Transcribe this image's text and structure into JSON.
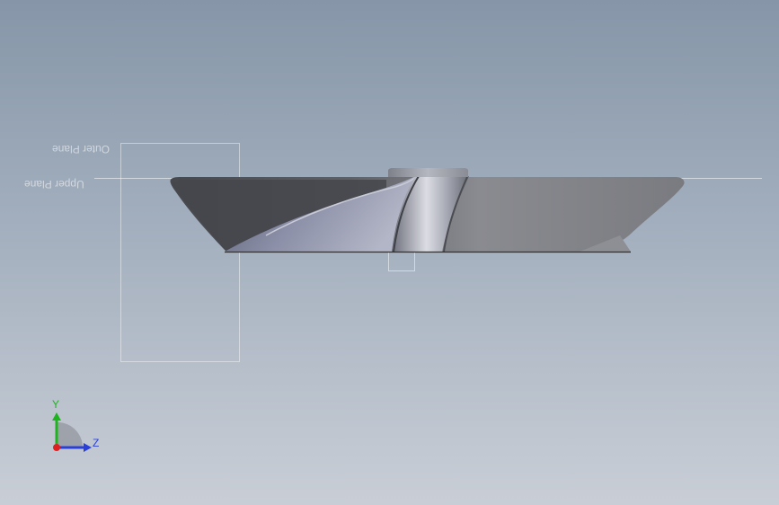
{
  "viewport": {
    "background_top": "#8696a8",
    "background_bottom": "#c9ced6"
  },
  "reference_planes": {
    "outer_plane_label": "Outer Plane",
    "upper_plane_label": "Upper Plane"
  },
  "model": {
    "name": "impeller",
    "blade_color": "#7c7e84",
    "shadow_color": "#45474c",
    "hub_color": "#b9bac2"
  },
  "triad": {
    "y_label": "Y",
    "z_label": "Z",
    "y_color": "#1fb31f",
    "z_color": "#2a3fd8",
    "x_color": "#e02020"
  }
}
